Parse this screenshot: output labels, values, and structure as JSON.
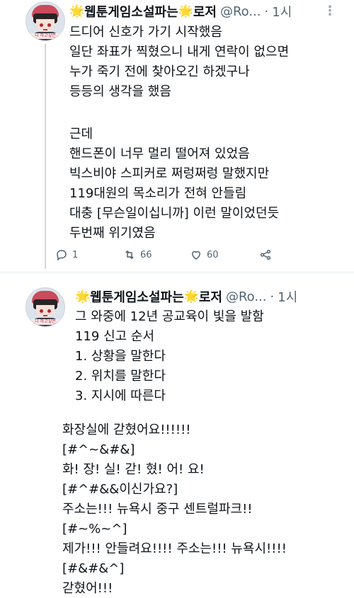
{
  "tweet1": {
    "name_prefix_star": "🌟",
    "name": "웹툰게임소설파는",
    "name_suffix_star": "🌟",
    "name_tail": "로저",
    "handle": "@Ro...",
    "dot": "·",
    "time": "1시",
    "more": "⋮",
    "lines": [
      "드디어 신호가 가기 시작했음",
      "일단 좌표가 찍혔으니 내게 연락이 없으면",
      "누가 죽기 전에 찾아오긴 하겠구나",
      "등등의 생각을 했음",
      "",
      "근데",
      "핸드폰이 너무 멀리 떨어져 있었음",
      "빅스비야 스피커로 쩌렁쩌렁 말했지만",
      "119대원의 목소리가 전혀 안들림",
      "대충 [무슨일이십니까] 이런 말이었던듯",
      "두번째 위기였음"
    ],
    "actions": {
      "reply_count": "1",
      "retweet_count": "66",
      "like_count": "60"
    }
  },
  "tweet2": {
    "name_prefix_star": "🌟",
    "name": "웹툰게임소설파는",
    "name_suffix_star": "🌟",
    "name_tail": "로저",
    "handle": "@Ro...",
    "dot": "·",
    "time": "1시",
    "more": "⋮",
    "lines": [
      "그 와중에 12년 공교육이 빛을 발함",
      "119 신고 순서",
      "1. 상황을 말한다",
      "2. 위치를 말한다",
      "3. 지시에 따른다",
      "",
      "화장실에 갇혔어요!!!!!!",
      "[#^~&#&]",
      "화! 장! 실! 갇! 혔! 어! 요!",
      "[#^#&&이신가요?]",
      "주소는!!! 뉴욕시 중구 센트럴파크!!",
      "[#~%~^]",
      "제가!!! 안들려요!!!! 주소는!!! 뉴욕시!!!!",
      "[#&#&^]",
      "갇혔어!!!"
    ]
  },
  "avatar": {
    "tag_text": "나 하고싶은"
  }
}
